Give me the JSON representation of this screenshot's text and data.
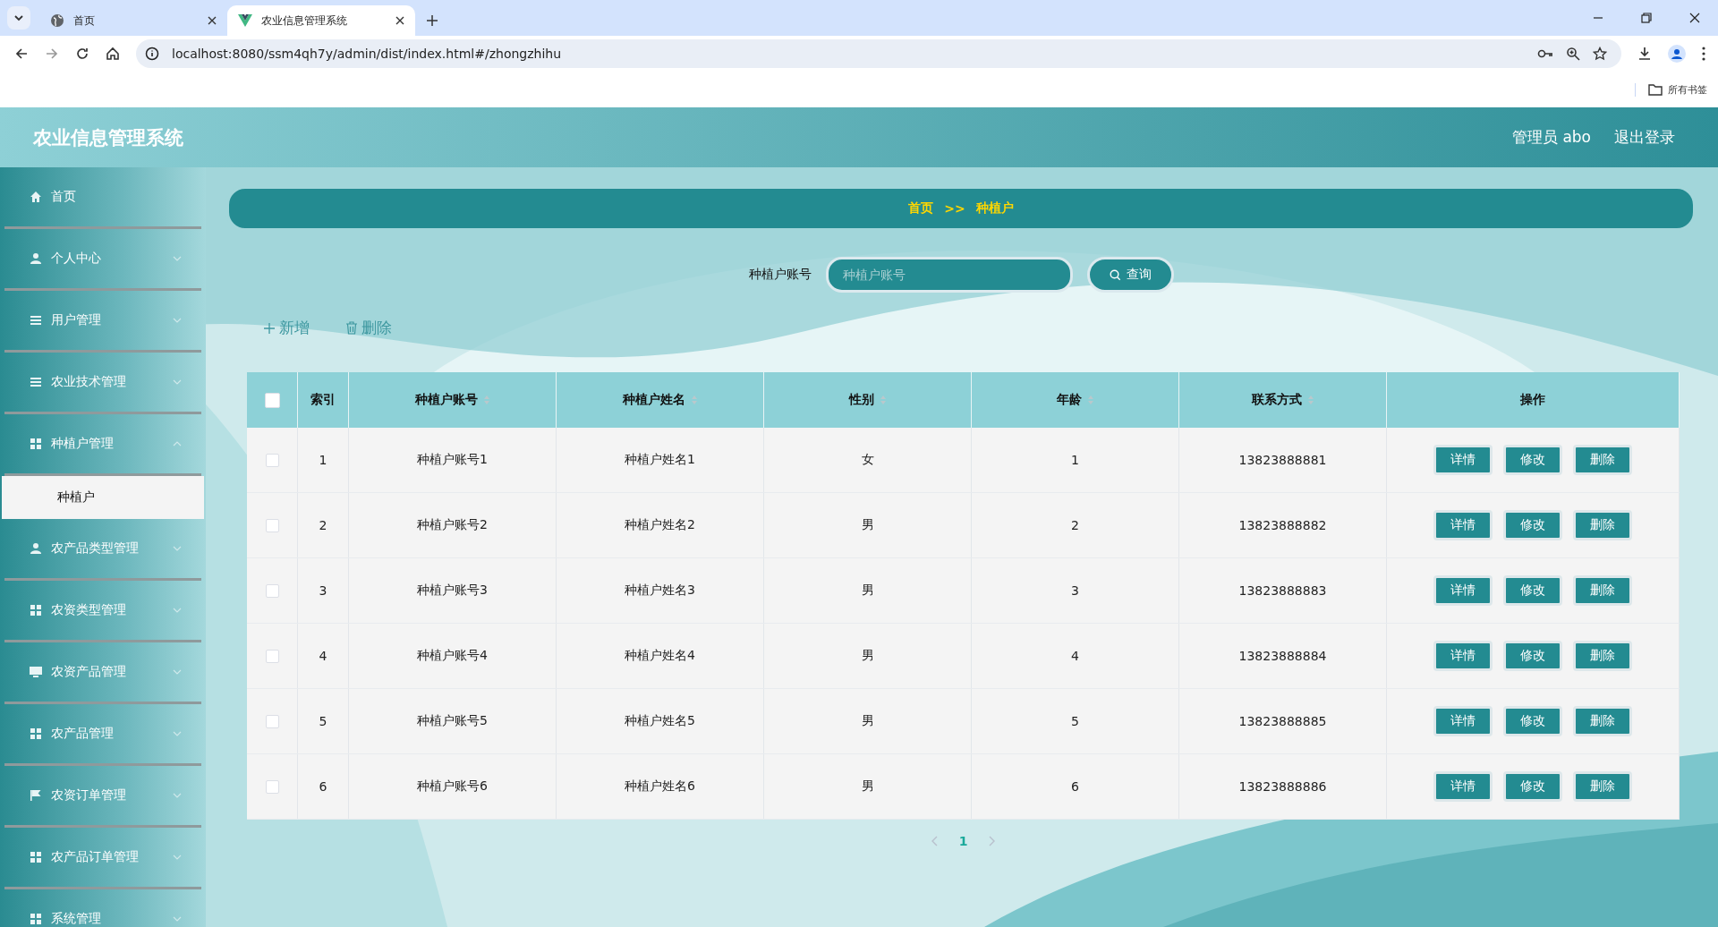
{
  "browser": {
    "tabs": [
      {
        "title": "首页",
        "selected": false
      },
      {
        "title": "农业信息管理系统",
        "selected": true
      }
    ],
    "address": "localhost:8080/ssm4qh7y/admin/dist/index.html#/zhongzhihu",
    "bookmarks": "所有书签"
  },
  "header": {
    "title": "农业信息管理系统",
    "user": "管理员 abo",
    "logout": "退出登录"
  },
  "sidebar": {
    "items": [
      {
        "label": "首页",
        "kind": "link"
      },
      {
        "label": "个人中心",
        "kind": "submenu",
        "expanded": false
      },
      {
        "label": "用户管理",
        "kind": "submenu",
        "expanded": false
      },
      {
        "label": "农业技术管理",
        "kind": "submenu",
        "expanded": false
      },
      {
        "label": "种植户管理",
        "kind": "submenu",
        "expanded": true,
        "children": [
          {
            "label": "种植户",
            "selected": true
          }
        ]
      },
      {
        "label": "农产品类型管理",
        "kind": "submenu",
        "expanded": false
      },
      {
        "label": "农资类型管理",
        "kind": "submenu",
        "expanded": false
      },
      {
        "label": "农资产品管理",
        "kind": "submenu",
        "expanded": false
      },
      {
        "label": "农产品管理",
        "kind": "submenu",
        "expanded": false
      },
      {
        "label": "农资订单管理",
        "kind": "submenu",
        "expanded": false
      },
      {
        "label": "农产品订单管理",
        "kind": "submenu",
        "expanded": false
      },
      {
        "label": "系统管理",
        "kind": "submenu",
        "expanded": false
      }
    ]
  },
  "breadcrumb": [
    "首页",
    ">>",
    "种植户"
  ],
  "search": {
    "label": "种植户账号",
    "placeholder": "种植户账号",
    "button": "查询"
  },
  "actions": [
    "新增",
    "删除"
  ],
  "table": {
    "all_checked": false,
    "columns": [
      {
        "label": "索引",
        "sortable": false
      },
      {
        "label": "种植户账号",
        "sortable": true
      },
      {
        "label": "种植户姓名",
        "sortable": true
      },
      {
        "label": "性别",
        "sortable": true
      },
      {
        "label": "年龄",
        "sortable": true
      },
      {
        "label": "联系方式",
        "sortable": true
      },
      {
        "label": "操作",
        "sortable": false
      }
    ],
    "rows": [
      {
        "checked": false,
        "cells": [
          "1",
          "种植户账号1",
          "种植户姓名1",
          "女",
          "1",
          "13823888881"
        ],
        "buttons": [
          "详情",
          "修改",
          "删除"
        ]
      },
      {
        "checked": false,
        "cells": [
          "2",
          "种植户账号2",
          "种植户姓名2",
          "男",
          "2",
          "13823888882"
        ],
        "buttons": [
          "详情",
          "修改",
          "删除"
        ]
      },
      {
        "checked": false,
        "cells": [
          "3",
          "种植户账号3",
          "种植户姓名3",
          "男",
          "3",
          "13823888883"
        ],
        "buttons": [
          "详情",
          "修改",
          "删除"
        ]
      },
      {
        "checked": false,
        "cells": [
          "4",
          "种植户账号4",
          "种植户姓名4",
          "男",
          "4",
          "13823888884"
        ],
        "buttons": [
          "详情",
          "修改",
          "删除"
        ]
      },
      {
        "checked": false,
        "cells": [
          "5",
          "种植户账号5",
          "种植户姓名5",
          "男",
          "5",
          "13823888885"
        ],
        "buttons": [
          "详情",
          "修改",
          "删除"
        ]
      },
      {
        "checked": false,
        "cells": [
          "6",
          "种植户账号6",
          "种植户姓名6",
          "男",
          "6",
          "13823888886"
        ],
        "buttons": [
          "详情",
          "修改",
          "删除"
        ]
      }
    ]
  },
  "pagination": {
    "pages": [
      {
        "label": "1",
        "selected": true
      }
    ]
  }
}
